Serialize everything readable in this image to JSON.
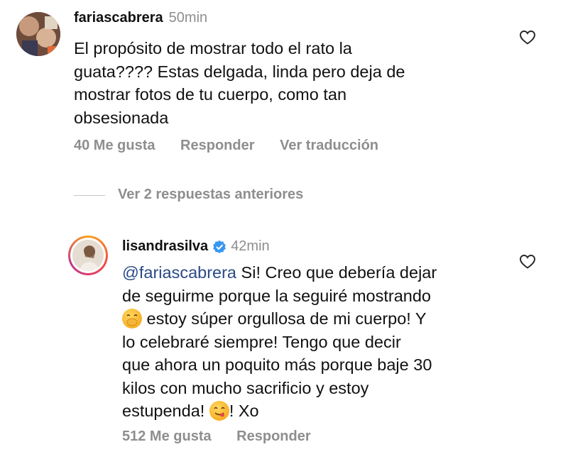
{
  "comments": [
    {
      "username": "fariascabrera",
      "time": "50min",
      "text_lines": [
        "El propósito de mostrar todo el rato la",
        "guata???? Estas delgada, linda pero deja de",
        "mostrar fotos de tu cuerpo, como tan",
        "obsesionada"
      ],
      "likes": "40 Me gusta",
      "reply_label": "Responder",
      "translate_label": "Ver traducción",
      "like_icon": "heart-outline-icon"
    }
  ],
  "view_replies_label": "Ver 2 respuestas anteriores",
  "reply": {
    "username": "lisandrasilva",
    "verified_icon": "verified-badge-icon",
    "time": "42min",
    "mention": "@fariascabrera",
    "line1_rest": " Si! Creo que debería dejar",
    "line2": "de seguirme porque la seguiré mostrando",
    "emoji1": "hand-over-mouth-emoji",
    "line3_rest": " estoy súper orgullosa de mi cuerpo! Y",
    "line4": "lo celebraré siempre! Tengo que decir",
    "line5": "que ahora un poquito más porque baje 30",
    "line6": "kilos con mucho sacrificio y estoy",
    "line7_start": "estupenda! ",
    "emoji2": "yummy-face-emoji",
    "line7_end": "! Xo",
    "likes": "512 Me gusta",
    "reply_label": "Responder",
    "like_icon": "heart-outline-icon"
  },
  "colors": {
    "text": "#111111",
    "secondary": "#8e8e8e",
    "mention": "#2a4a86",
    "verified": "#3897f0"
  }
}
